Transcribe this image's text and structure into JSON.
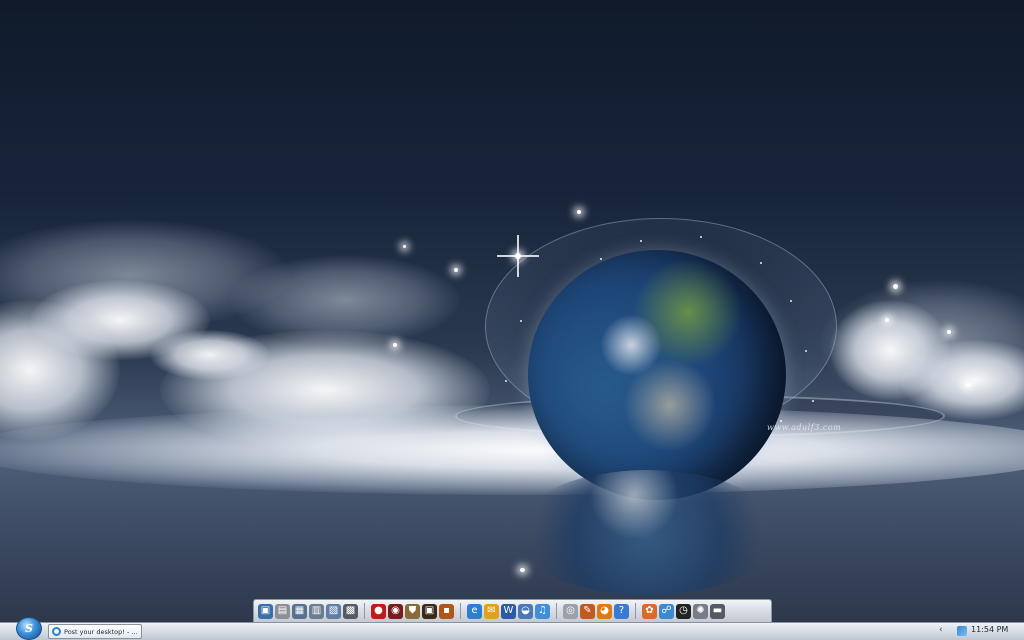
{
  "wallpaper": {
    "watermark": "www.adulf3.com"
  },
  "dock": {
    "icons": [
      {
        "name": "computer-icon",
        "glyph": "▣",
        "color": "#3a6fa8"
      },
      {
        "name": "drive-icon",
        "glyph": "▤",
        "color": "#8c9096"
      },
      {
        "name": "folder-icon",
        "glyph": "▦",
        "color": "#58708f"
      },
      {
        "name": "documents-icon",
        "glyph": "▥",
        "color": "#6d7c8f"
      },
      {
        "name": "pictures-icon",
        "glyph": "▧",
        "color": "#5f7da6"
      },
      {
        "name": "video-icon",
        "glyph": "▩",
        "color": "#555a63"
      },
      {
        "name": "game-red-icon",
        "glyph": "●",
        "color": "#c01a1a"
      },
      {
        "name": "game-disc-icon",
        "glyph": "◉",
        "color": "#7a1c1c"
      },
      {
        "name": "shield-icon",
        "glyph": "⛊",
        "color": "#8a6a3a"
      },
      {
        "name": "frame-icon",
        "glyph": "▣",
        "color": "#3b2a1a"
      },
      {
        "name": "orange-box-icon",
        "glyph": "▪",
        "color": "#b0561a"
      },
      {
        "name": "browser-icon",
        "glyph": "e",
        "color": "#2d7fd2"
      },
      {
        "name": "mail-icon",
        "glyph": "✉",
        "color": "#e0a020"
      },
      {
        "name": "word-icon",
        "glyph": "W",
        "color": "#2a5aa8"
      },
      {
        "name": "media-icon",
        "glyph": "◒",
        "color": "#4a78b8"
      },
      {
        "name": "music-icon",
        "glyph": "♫",
        "color": "#3f8ed8"
      },
      {
        "name": "cd-icon",
        "glyph": "◎",
        "color": "#9aa1ab"
      },
      {
        "name": "tools-icon",
        "glyph": "✎",
        "color": "#c05a20"
      },
      {
        "name": "firefox-icon",
        "glyph": "◕",
        "color": "#e07a10"
      },
      {
        "name": "help-icon",
        "glyph": "?",
        "color": "#3a7ad0"
      },
      {
        "name": "paint-icon",
        "glyph": "✿",
        "color": "#d86a2a"
      },
      {
        "name": "network-icon",
        "glyph": "☍",
        "color": "#3a8ad0"
      },
      {
        "name": "clock-icon",
        "glyph": "◷",
        "color": "#222222"
      },
      {
        "name": "settings-icon",
        "glyph": "✺",
        "color": "#777d86"
      },
      {
        "name": "trash-icon",
        "glyph": "▬",
        "color": "#555b63"
      }
    ]
  },
  "taskbar": {
    "start_glyph": "S",
    "task_label": "Post your desktop! - ...",
    "tray_chevron": "‹",
    "clock": "11:54 PM"
  }
}
